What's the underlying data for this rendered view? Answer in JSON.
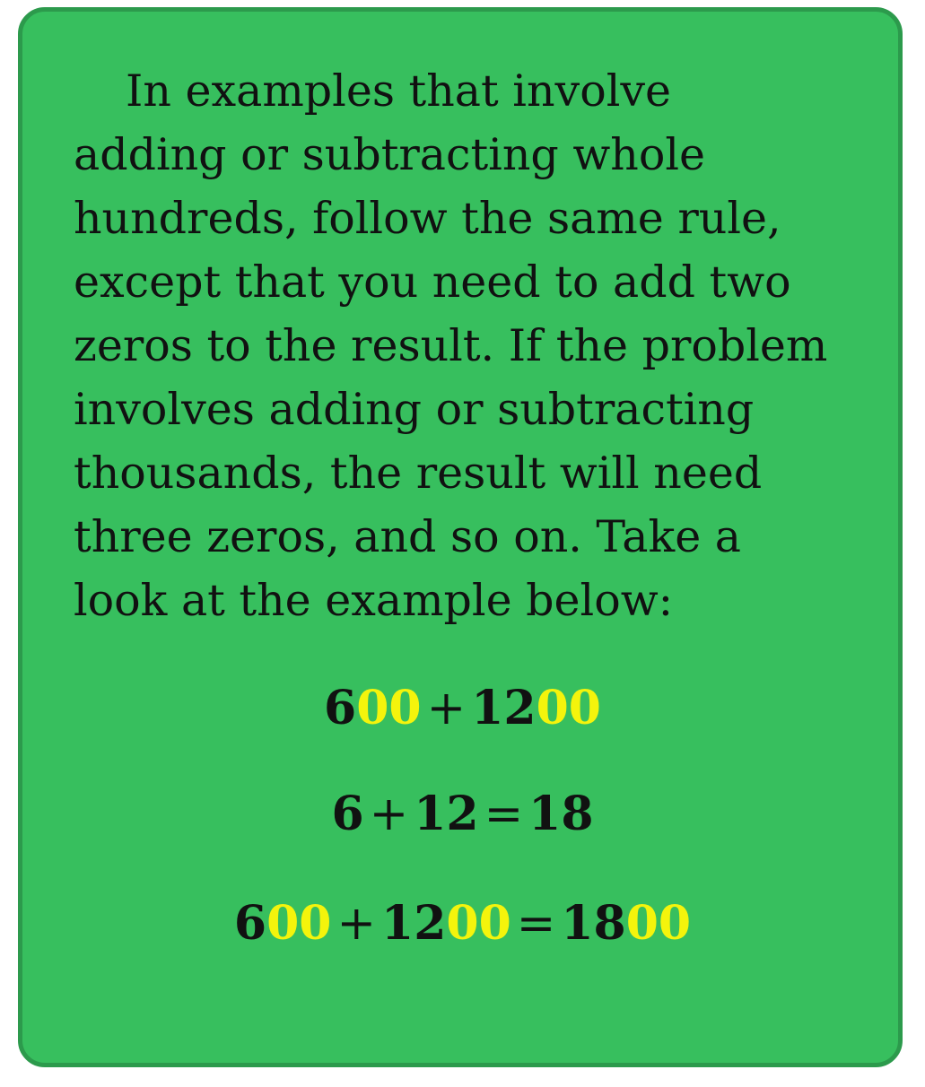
{
  "paragraph_lines": [
    "In examples that involve",
    "adding or subtracting whole",
    "hundreds, follow the same rule,",
    "except that you need to add two",
    "zeros to the result. If the problem",
    "involves adding or subtracting",
    "thousands, the result will need",
    "three zeros, and so on. Take a",
    "look at the example below:"
  ],
  "equations": {
    "eq1": {
      "a_digits": "6",
      "a_zeros": "00",
      "op1": "+",
      "b_digits": "12",
      "b_zeros": "00"
    },
    "eq2": {
      "a": "6",
      "op1": "+",
      "b": "12",
      "op2": "=",
      "c": "18"
    },
    "eq3": {
      "a_digits": "6",
      "a_zeros": "00",
      "op1": "+",
      "b_digits": "12",
      "b_zeros": "00",
      "op2": "=",
      "c_digits": "18",
      "c_zeros": "00"
    }
  },
  "colors": {
    "card_background": "#37bf5e",
    "card_border": "#2c9a4c",
    "text": "#111111",
    "zeros_highlight": "#f4f40c"
  }
}
